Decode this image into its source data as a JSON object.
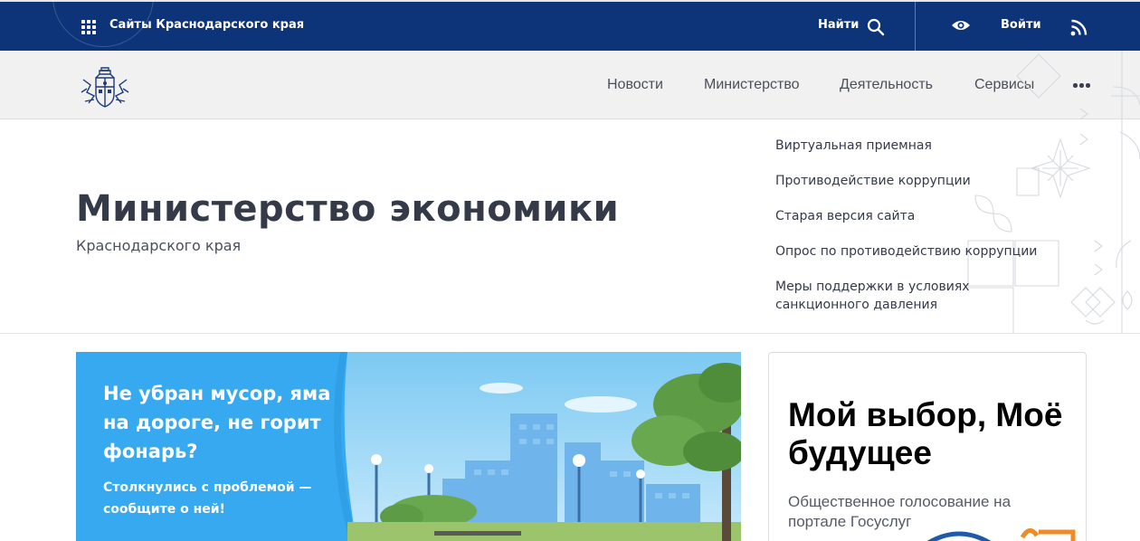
{
  "topbar": {
    "sites_label": "Сайты Краснодарского края",
    "find_label": "Найти",
    "login_label": "Войти",
    "icons": [
      "grid-icon",
      "search-icon",
      "eye-icon",
      "rss-icon"
    ]
  },
  "nav": {
    "items": [
      {
        "label": "Новости"
      },
      {
        "label": "Министерство"
      },
      {
        "label": "Деятельность"
      },
      {
        "label": "Сервисы"
      }
    ],
    "more_icon": "more-horizontal-icon"
  },
  "hero": {
    "title": "Министерство экономики",
    "subtitle": "Краснодарского края"
  },
  "quick_links": [
    {
      "label": "Виртуальная приемная"
    },
    {
      "label": "Противодействие коррупции"
    },
    {
      "label": "Старая версия сайта"
    },
    {
      "label": "Опрос по противодействию коррупции"
    },
    {
      "label_line1": "Меры поддержки в условиях",
      "label_line2": "санкционного давления"
    }
  ],
  "banner": {
    "title": "Не убран мусор, яма на дороге, не горит фонарь?",
    "text": "Столкнулись с проблемой — сообщите о ней!"
  },
  "vote_card": {
    "title": "Мой выбор, Моё будущее",
    "text": "Общественное голосование на портале Госуслуг"
  },
  "colors": {
    "topbar_bg": "#0d3479",
    "nav_bg": "#f1f1f1",
    "banner_bg": "#36a9f0",
    "heading": "#353a48"
  }
}
